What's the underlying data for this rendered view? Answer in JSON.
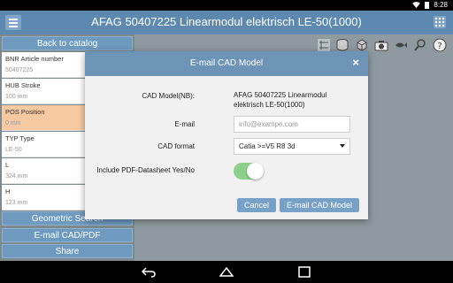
{
  "status_bar": {
    "time": "8:28"
  },
  "title_bar": {
    "title": "AFAG 50407225 Linearmodul elektrisch LE-50(1000)"
  },
  "sidebar": {
    "back_label": "Back to catalog",
    "properties": [
      {
        "label": "BNR Article number",
        "value": "50407225",
        "highlighted": false
      },
      {
        "label": "HUB Stroke",
        "value": "100 mm",
        "highlighted": false
      },
      {
        "label": "POS Position",
        "value": "0 mm",
        "highlighted": true
      },
      {
        "label": "TYP Type",
        "value": "LE-50",
        "highlighted": false
      },
      {
        "label": "L",
        "value": "324 mm",
        "highlighted": false
      },
      {
        "label": "H",
        "value": "123 mm",
        "highlighted": false
      }
    ],
    "buttons": {
      "geometric_search": "Geometric Search",
      "email_cad": "E-mail CAD/PDF",
      "share": "Share"
    }
  },
  "toolbar": {
    "icons": [
      "dimension-icon",
      "database-icon",
      "cube-view-icon",
      "camera-icon",
      "fish-icon",
      "zoom-icon",
      "help-icon"
    ]
  },
  "dialog": {
    "title": "E-mail CAD Model",
    "close": "×",
    "model_label": "CAD Model(NB):",
    "model_value": "AFAG 50407225 Linearmodul elektrisch LE-50(1000)",
    "email_label": "E-mail",
    "email_placeholder": "info@exampe.com",
    "format_label": "CAD format",
    "format_value": "Catia >=V5 R8 3d",
    "pdf_label": "Include PDF-Datasheet Yes/No",
    "pdf_enabled": true,
    "cancel_label": "Cancel",
    "submit_label": "E-mail CAD Model"
  },
  "colors": {
    "accent": "#5d89b0",
    "highlight": "#f7c9a3",
    "toggle_on": "#8ccf8a"
  }
}
